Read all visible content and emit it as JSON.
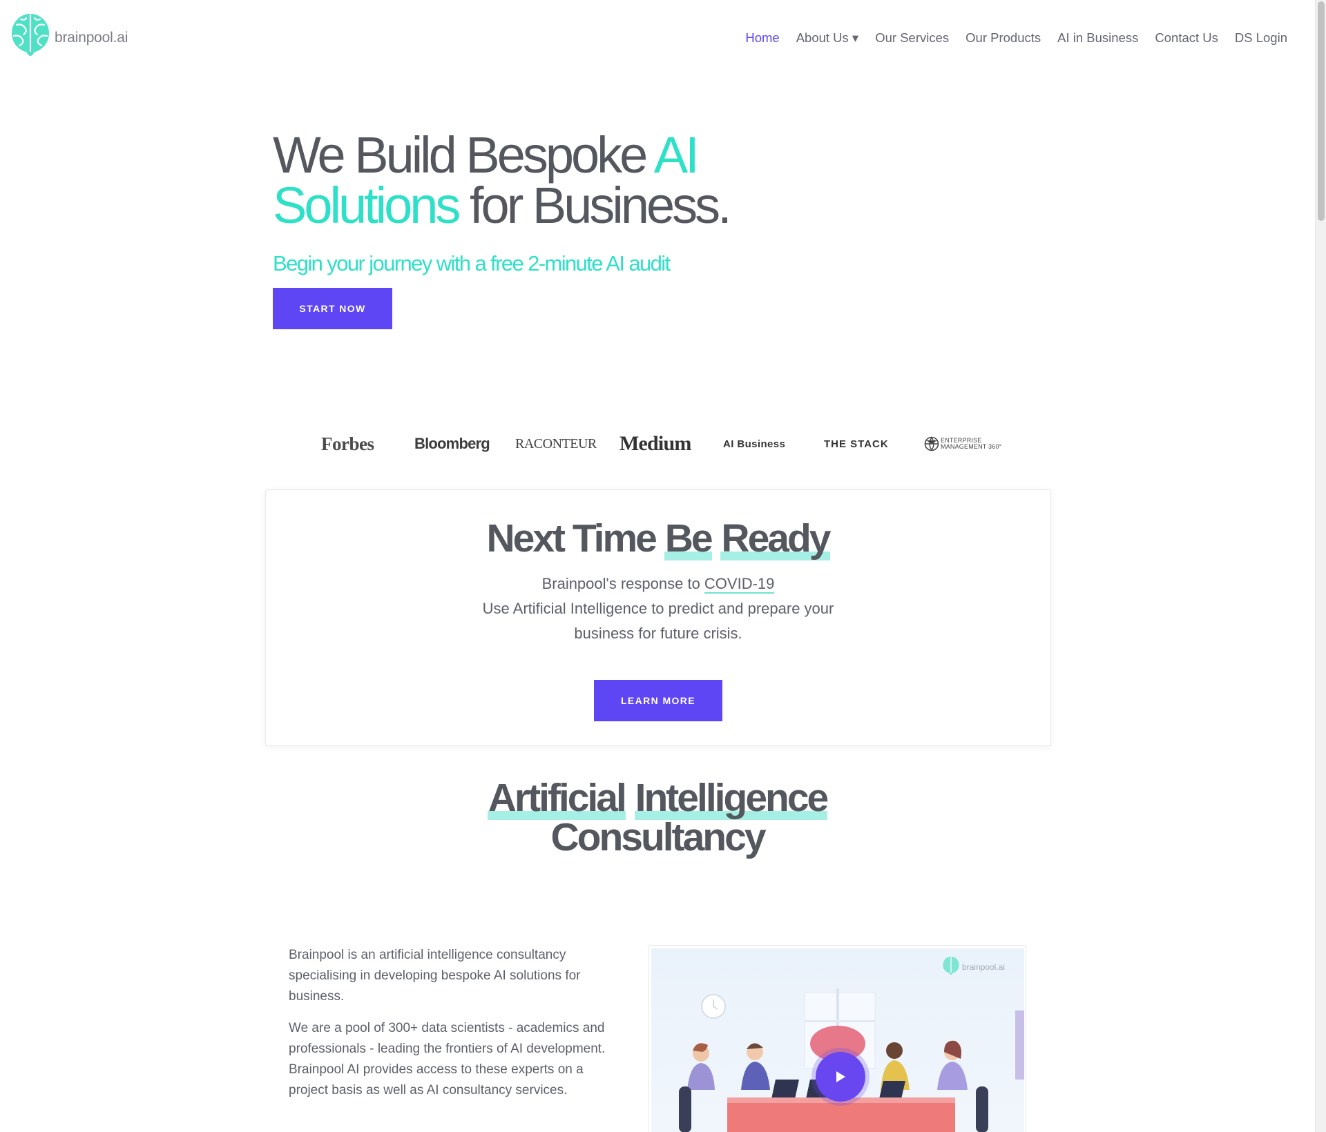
{
  "brand": {
    "logo_text": "brainpool.ai",
    "teal": "#2ee0c7",
    "purple": "#5f46f5"
  },
  "nav": {
    "items": [
      {
        "label": "Home",
        "active": true
      },
      {
        "label": "About Us ▾",
        "active": false
      },
      {
        "label": "Our Services",
        "active": false
      },
      {
        "label": "Our Products",
        "active": false
      },
      {
        "label": "AI in Business",
        "active": false
      },
      {
        "label": "Contact Us",
        "active": false
      },
      {
        "label": "DS Login",
        "active": false
      }
    ]
  },
  "hero": {
    "title_part1": "We Build Bespoke ",
    "title_accent1": "AI",
    "title_accent2": "Solutions",
    "title_part2": " for Business.",
    "subtitle": "Begin your journey with a free 2-minute AI audit",
    "cta_label": "START NOW"
  },
  "press": {
    "forbes": "Forbes",
    "bloomberg": "Bloomberg",
    "raconteur": "RACONTEUR",
    "medium": "Medium",
    "aibusiness": "AI Business",
    "thestack": "THE STACK",
    "em360_line1": "ENTERPRISE",
    "em360_line2": "MANAGEMENT 360°"
  },
  "covid_card": {
    "title_part1": "Next Time ",
    "title_hl1": "Be",
    "title_hl2": "Ready",
    "line1_prefix": "Brainpool's response to ",
    "line1_link": "COVID-19",
    "line2": "Use Artificial Intelligence to predict and prepare your",
    "line3": "business for future crisis.",
    "cta_label": "LEARN MORE"
  },
  "consultancy": {
    "title_hl1": "Artificial",
    "title_hl2": "Intelligence",
    "title_line2": "Consultancy",
    "para1": "Brainpool is an artificial intelligence consultancy specialising in developing bespoke AI solutions for business.",
    "para2": "We are a pool of 300+ data scientists - academics and professionals - leading the frontiers of AI development. Brainpool AI provides access to these experts on a project basis as well as AI consultancy services.",
    "video_brand": "brainpool.ai"
  }
}
